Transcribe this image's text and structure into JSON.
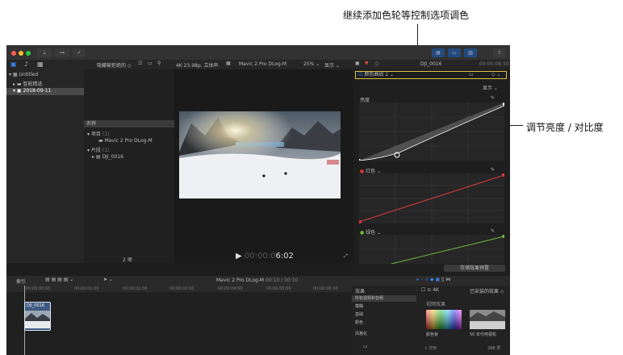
{
  "annotations": {
    "top": "继续添加色轮等控制选项调色",
    "right": "调节亮度 / 对比度"
  },
  "library": {
    "name": "Untitled",
    "smart": "智能精选",
    "event": "2018-09-11"
  },
  "browser": {
    "filter": "隐藏被拒绝的 ◇",
    "col_header": "名称",
    "group_project": "项目",
    "group_project_count": "(1)",
    "project_item": "Mavic 2 Pro DLog-M",
    "group_clip": "片段",
    "group_clip_count": "(1)",
    "clip_item": "DJI_0016",
    "footer_count": "2 项"
  },
  "viewer": {
    "format": "4K 23.98p, 立体声",
    "title": "Mavic 2 Pro DLog-M",
    "zoom": "25% ⌄",
    "view": "显示 ⌄",
    "timecode": "6:02"
  },
  "inspector": {
    "clip_name": "DJI_0016",
    "clip_time": "00:00:08:10",
    "effect_name": "颜色曲线 1 ⌄",
    "show": "显示 ⌄",
    "sections": [
      "亮度",
      "红色 ⌄",
      "绿色 ⌄"
    ],
    "save_preset": "存储效果预置"
  },
  "timeline": {
    "index": "索引",
    "title": "Mavic 2 Pro DLog-M",
    "duration": "00:10 / 00:10",
    "clip_label": "DJI_0016",
    "ruler": [
      "00:00:00:00",
      "00:00:01:00",
      "00:00:02:00",
      "00:00:03:00",
      "00:00:04:00",
      "00:00:05:00",
      "00:00:06:00",
      "00:00:07:00"
    ]
  },
  "effects": {
    "header": "效果",
    "filter": "4K",
    "installed": "已安装的效果 ◇",
    "categories": [
      "所有视频和音频",
      "模糊",
      "基础",
      "颜色",
      "风格化"
    ],
    "group_title": "视频效果",
    "items": [
      "颜色板",
      "50 年代电视机"
    ],
    "search_placeholder": "搜索",
    "count": "288 项"
  },
  "colors": {
    "accent": "#3b86f0",
    "selection": "#e0c341",
    "red_curve": "#e0393c",
    "green_curve": "#6dbb3a"
  }
}
